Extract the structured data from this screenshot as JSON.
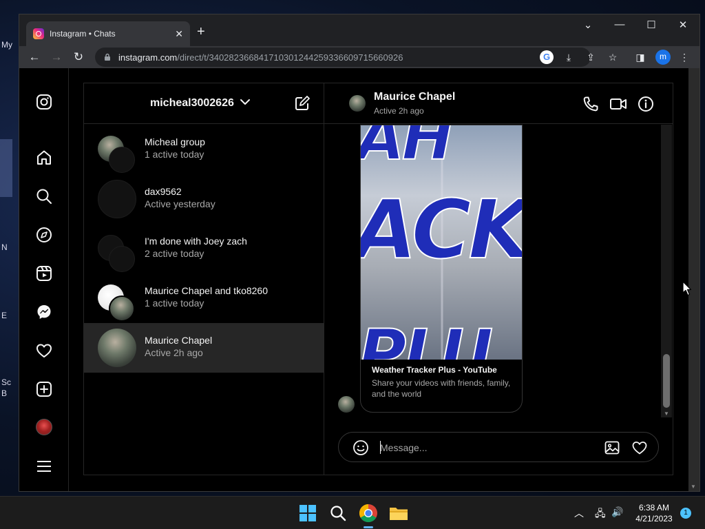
{
  "desktop": {
    "side_glyphs": [
      {
        "text": "My"
      },
      {
        "text": "N"
      },
      {
        "text": "E"
      },
      {
        "text": "Sc"
      },
      {
        "text": "B"
      }
    ]
  },
  "browser": {
    "tab_title": "Instagram • Chats",
    "new_tab": "+",
    "url_host": "instagram.com",
    "url_path": "/direct/t/340282366841710301244259336609715660926",
    "profile_initial": "m",
    "controls": {
      "chevron": "⌄",
      "minimize": "—",
      "maximize": "☐",
      "close": "✕"
    }
  },
  "instagram": {
    "account": "micheal3002626",
    "threads": [
      {
        "name": "Micheal group",
        "sub": "1 active today",
        "avatar": "group-photo"
      },
      {
        "name": "dax9562",
        "sub": "Active yesterday",
        "avatar": "dark"
      },
      {
        "name": "I'm done with Joey zach",
        "sub": "2 active today",
        "avatar": "group-dark"
      },
      {
        "name": "Maurice Chapel and tko8260",
        "sub": "1 active today",
        "avatar": "group-white"
      },
      {
        "name": "Maurice Chapel",
        "sub": "Active 2h ago",
        "avatar": "photo",
        "selected": true
      }
    ],
    "chat": {
      "name": "Maurice Chapel",
      "status": "Active 2h ago",
      "link_card": {
        "image_text": [
          "AH",
          "ACK",
          "PLU"
        ],
        "title": "Weather Tracker Plus - YouTube",
        "description": "Share your videos with friends, family, and the world"
      },
      "composer_placeholder": "Message..."
    }
  },
  "taskbar": {
    "time": "6:38 AM",
    "date": "4/21/2023",
    "notifications": "1",
    "tray_chevron": "︿"
  },
  "colors": {
    "accent": "#5fb2f2",
    "ig_bg": "#000000",
    "selected_thread": "#262626",
    "link_text_blue": "#1f2db8"
  }
}
